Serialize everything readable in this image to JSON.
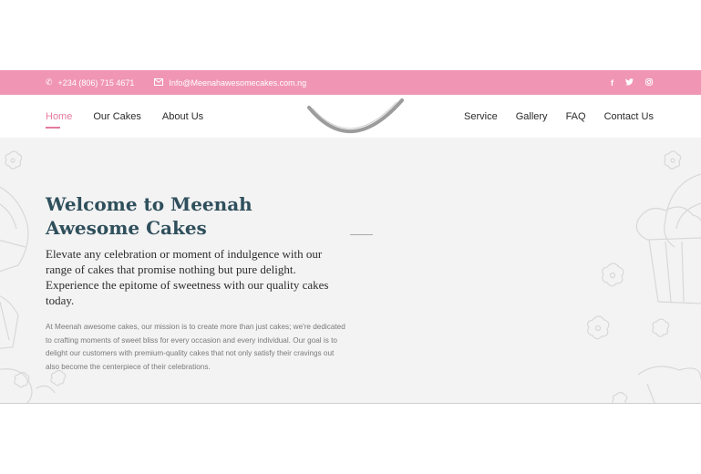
{
  "topbar": {
    "phone": "+234 (806) 715 4671",
    "email": "Info@Meenahawesomecakes.com.ng",
    "phone_icon": "phone-icon",
    "email_icon": "mail-icon",
    "social": [
      "facebook-icon",
      "twitter-icon",
      "instagram-icon"
    ],
    "bg_color": "#f096b4"
  },
  "nav": {
    "left": [
      "Home",
      "Our Cakes",
      "About Us"
    ],
    "right": [
      "Service",
      "Gallery",
      "FAQ",
      "Contact Us"
    ],
    "active": "Home",
    "accent": "#e57aa0"
  },
  "hero": {
    "title": "Welcome to Meenah Awesome Cakes",
    "lead": "Elevate any celebration or moment of indulgence with our range of cakes that promise nothing but pure delight. Experience the epitome of sweetness with our quality cakes today.",
    "body": "At Meenah awesome cakes, our mission is to create more than just cakes; we're dedicated to crafting moments of sweet bliss for every occasion and every individual. Our goal is to delight our customers with premium-quality cakes that not only satisfy their cravings out also become the centerpiece of their celebrations.",
    "title_color": "#2f4f5c"
  }
}
